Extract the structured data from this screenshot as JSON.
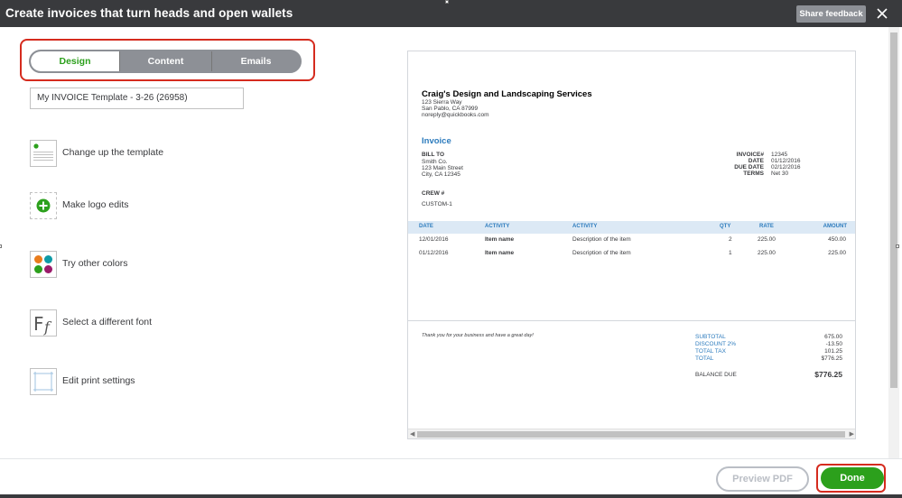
{
  "header": {
    "title": "Create invoices that turn heads and open wallets",
    "share_label": "Share feedback"
  },
  "tabs": [
    {
      "label": "Design"
    },
    {
      "label": "Content"
    },
    {
      "label": "Emails"
    }
  ],
  "template_name": "My INVOICE Template - 3-26 (26958)",
  "options": [
    {
      "label": "Change up the template",
      "icon": "template-icon"
    },
    {
      "label": "Make logo edits",
      "icon": "add-logo-icon"
    },
    {
      "label": "Try other colors",
      "icon": "color-palette-icon"
    },
    {
      "label": "Select a different font",
      "icon": "font-icon"
    },
    {
      "label": "Edit print settings",
      "icon": "print-settings-icon"
    }
  ],
  "invoice": {
    "company": "Craig's Design and Landscaping Services",
    "address1": "123 Sierra Way",
    "address2": "San Pablo, CA 87999",
    "email": "noreply@quickbooks.com",
    "title": "Invoice",
    "bill_to_label": "BILL TO",
    "bill_to": [
      "Smith Co.",
      "123 Main Street",
      "City, CA 12345"
    ],
    "meta": [
      {
        "label": "INVOICE#",
        "value": "12345"
      },
      {
        "label": "DATE",
        "value": "01/12/2016"
      },
      {
        "label": "DUE DATE",
        "value": "02/12/2016"
      },
      {
        "label": "TERMS",
        "value": "Net 30"
      }
    ],
    "crew_label": "CREW #",
    "crew_value": "CUSTOM-1",
    "columns": [
      "DATE",
      "ACTIVITY",
      "ACTIVITY",
      "QTY",
      "RATE",
      "AMOUNT"
    ],
    "rows": [
      [
        "12/01/2016",
        "Item name",
        "Description of the item",
        "2",
        "225.00",
        "450.00"
      ],
      [
        "01/12/2016",
        "Item name",
        "Description of the item",
        "1",
        "225.00",
        "225.00"
      ]
    ],
    "thank_you": "Thank you for your business and have a great day!",
    "totals": [
      {
        "label": "SUBTOTAL",
        "value": "675.00"
      },
      {
        "label": "DISCOUNT 2%",
        "value": "-13.50"
      },
      {
        "label": "TOTAL TAX",
        "value": "101.25"
      },
      {
        "label": "TOTAL",
        "value": "$776.25"
      }
    ],
    "balance_label": "BALANCE DUE",
    "balance_value": "$776.25"
  },
  "footer": {
    "preview_label": "Preview PDF",
    "done_label": "Done"
  },
  "colors": {
    "accent_green": "#2ca01c",
    "highlight_red": "#d52b1e",
    "header_bg": "#393a3d",
    "invoice_blue": "#2c7bbd"
  }
}
